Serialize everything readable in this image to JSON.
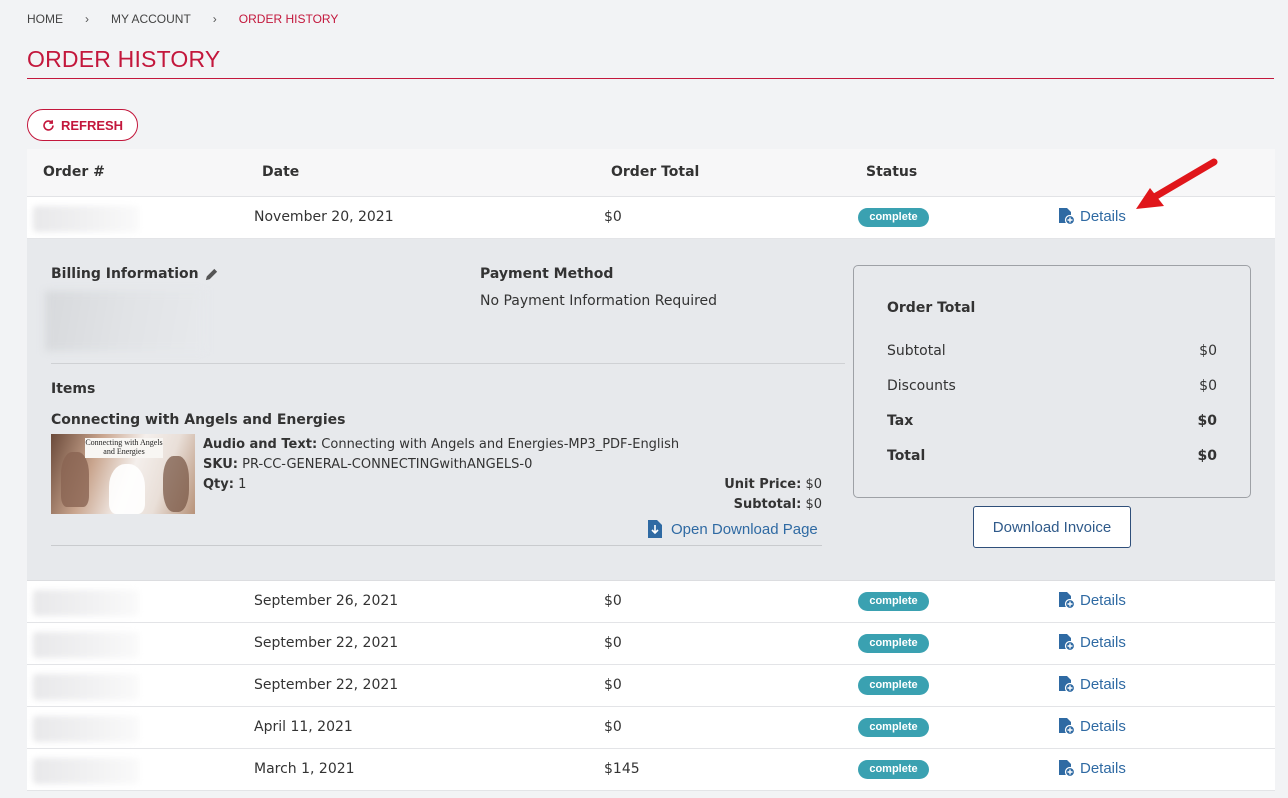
{
  "breadcrumb": {
    "home": "HOME",
    "account": "MY ACCOUNT",
    "current": "ORDER HISTORY",
    "separator": "›"
  },
  "page": {
    "title": "ORDER HISTORY",
    "refresh_label": "REFRESH",
    "accent_color": "#c3173c"
  },
  "table": {
    "headers": {
      "order": "Order #",
      "date": "Date",
      "total": "Order Total",
      "status": "Status"
    },
    "details_label": "Details",
    "rows": [
      {
        "date": "November 20, 2021",
        "total": "$0",
        "status": "complete"
      },
      {
        "date": "September 26, 2021",
        "total": "$0",
        "status": "complete"
      },
      {
        "date": "September 22, 2021",
        "total": "$0",
        "status": "complete"
      },
      {
        "date": "September 22, 2021",
        "total": "$0",
        "status": "complete"
      },
      {
        "date": "April 11, 2021",
        "total": "$0",
        "status": "complete"
      },
      {
        "date": "March 1, 2021",
        "total": "$145",
        "status": "complete"
      }
    ]
  },
  "detail": {
    "billing_title": "Billing Information",
    "payment_title": "Payment Method",
    "payment_value": "No Payment Information Required",
    "items_title": "Items",
    "item": {
      "name": "Connecting with Angels and Energies",
      "thumb_title": "Connecting with Angels and Energies",
      "audio_label": "Audio and Text:",
      "audio_value": "Connecting with Angels and Energies-MP3_PDF-English",
      "sku_label": "SKU:",
      "sku_value": "PR-CC-GENERAL-CONNECTINGwithANGELS-0",
      "qty_label": "Qty:",
      "qty_value": "1",
      "unit_price_label": "Unit Price:",
      "unit_price_value": "$0",
      "subtotal_label": "Subtotal:",
      "subtotal_value": "$0",
      "download_label": "Open Download Page"
    },
    "summary": {
      "title": "Order Total",
      "subtotal_label": "Subtotal",
      "subtotal_value": "$0",
      "discounts_label": "Discounts",
      "discounts_value": "$0",
      "tax_label": "Tax",
      "tax_value": "$0",
      "total_label": "Total",
      "total_value": "$0"
    },
    "invoice_label": "Download Invoice"
  }
}
